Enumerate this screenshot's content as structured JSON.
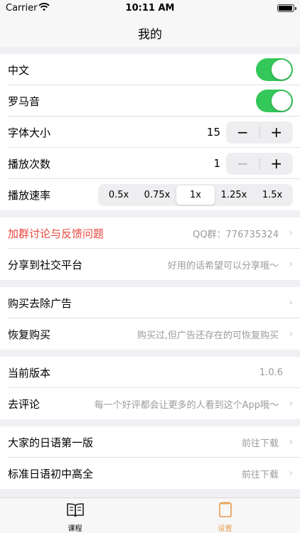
{
  "status": {
    "carrier": "Carrier",
    "time": "10:11 AM"
  },
  "nav": {
    "title": "我的"
  },
  "settings": {
    "chinese": {
      "label": "中文",
      "on": true
    },
    "romaji": {
      "label": "罗马音",
      "on": true
    },
    "font_size": {
      "label": "字体大小",
      "value": "15",
      "minus": "−",
      "plus": "+"
    },
    "play_count": {
      "label": "播放次数",
      "value": "1",
      "minus": "−",
      "plus": "+"
    },
    "play_speed": {
      "label": "播放速率",
      "options": [
        "0.5x",
        "0.75x",
        "1x",
        "1.25x",
        "1.5x"
      ],
      "selected": "1x"
    }
  },
  "feedback": {
    "join_group": {
      "label": "加群讨论与反馈问题",
      "detail": "QQ群：776735324"
    },
    "share": {
      "label": "分享到社交平台",
      "detail": "好用的话希望可以分享哦～"
    }
  },
  "purchase": {
    "remove_ads": {
      "label": "购买去除广告",
      "detail": ""
    },
    "restore": {
      "label": "恢复购买",
      "detail": "购买过,但广告还存在的可恢复购买"
    }
  },
  "about": {
    "version": {
      "label": "当前版本",
      "detail": "1.0.6"
    },
    "review": {
      "label": "去评论",
      "detail": "每一个好评都会让更多的人看到这个App哦～"
    }
  },
  "apps": {
    "app1": {
      "label": "大家的日语第一版",
      "detail": "前往下载"
    },
    "app2": {
      "label": "标准日语初中高全",
      "detail": "前往下载"
    }
  },
  "tabs": [
    {
      "label": "课程",
      "icon": "book-icon",
      "active": false
    },
    {
      "label": "设置",
      "icon": "notebook-icon",
      "active": true
    }
  ],
  "colors": {
    "toggle_on": "#34c759",
    "accent": "#e89a4a",
    "red": "#e8453c"
  }
}
